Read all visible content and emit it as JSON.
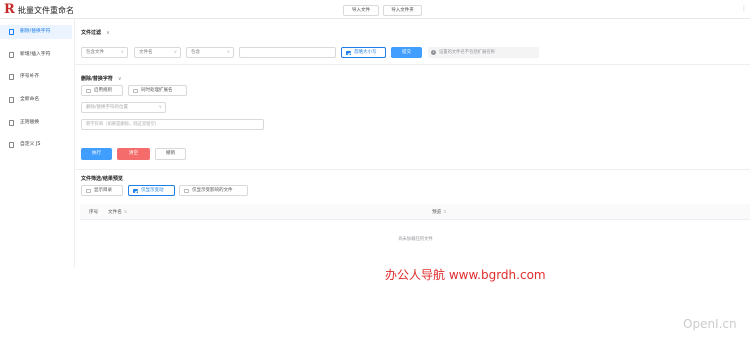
{
  "app": {
    "title": "批量文件重命名",
    "import_file": "导入文件",
    "import_folder": "导入文件夹",
    "more": "⋮"
  },
  "sidebar": {
    "items": [
      {
        "label": "删除/替换字符",
        "icon": "file-delete-icon"
      },
      {
        "label": "新增/插入字符",
        "icon": "file-add-icon"
      },
      {
        "label": "序号补齐",
        "icon": "sequence-icon"
      },
      {
        "label": "全新命名",
        "icon": "new-name-icon"
      },
      {
        "label": "正则替换",
        "icon": "regex-icon"
      },
      {
        "label": "自定义 JS",
        "icon": "code-icon"
      }
    ]
  },
  "filter": {
    "title": "文件过滤",
    "chevron": "∨",
    "scope": "包含文件",
    "field": "文件名",
    "op": "包含",
    "value": "",
    "ignore_case": "忽略大小写",
    "submit": "提交",
    "hint": "设置的文件名不包括扩展名称"
  },
  "rule": {
    "title": "删除/替换字符",
    "chevron": "∨",
    "enable_rule": "启用规则",
    "process_ext": "同时处理扩展名",
    "position_placeholder": "删除/替换字符的位置",
    "new_char_placeholder": "新字符串（如果是删除，则这里留空）"
  },
  "actions": {
    "execute": "执行",
    "clear": "清空",
    "undo": "撤销"
  },
  "preview": {
    "title": "文件筛选/结果预览",
    "show_dir": "显示目录",
    "only_changed": "仅显示变动",
    "only_affected": "仅显示受影响的文件",
    "columns": [
      "序号",
      "文件名",
      "预览"
    ],
    "empty": "尚未加载任何文件"
  },
  "watermark": "办公人导航 www.bgrdh.com",
  "brand_mark": "OpenI.cn",
  "colors": {
    "accent": "#409eff",
    "danger": "#f56c6c",
    "logo": "#c62828"
  }
}
